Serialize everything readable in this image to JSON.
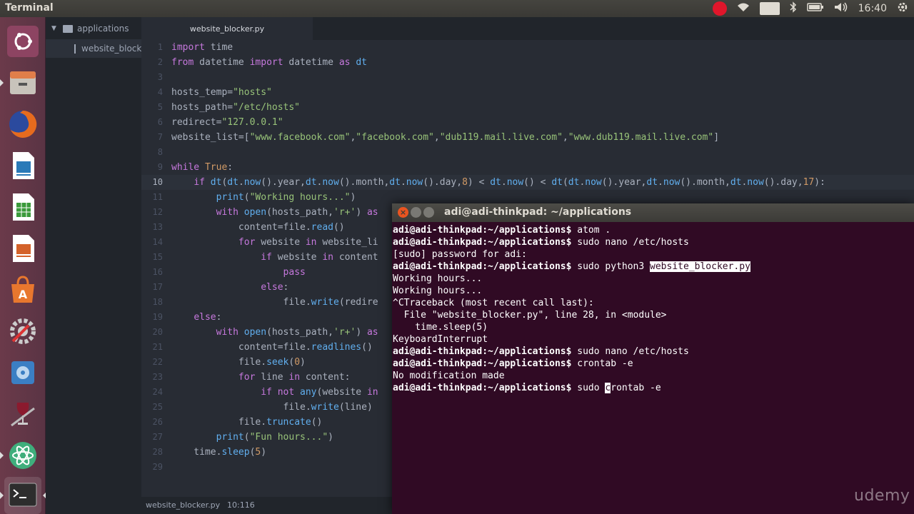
{
  "top_panel": {
    "app_title": "Terminal",
    "keyboard_layout": "No",
    "clock": "16:40"
  },
  "launcher": {
    "items": [
      "ubuntu-dash-icon",
      "files-icon",
      "firefox-icon",
      "writer-icon",
      "calc-icon",
      "impress-icon",
      "software-center-icon",
      "system-settings-icon",
      "disk-utility-icon",
      "wine-tools-icon",
      "atom-icon",
      "terminal-icon"
    ]
  },
  "tree": {
    "folder": "applications",
    "file": "website_blocker"
  },
  "tab": {
    "label": "website_blocker.py"
  },
  "editor": {
    "current_line": 10,
    "lines": [
      "import time",
      "from datetime import datetime as dt",
      "",
      "hosts_temp=\"hosts\"",
      "hosts_path=\"/etc/hosts\"",
      "redirect=\"127.0.0.1\"",
      "website_list=[\"www.facebook.com\",\"facebook.com\",\"dub119.mail.live.com\",\"www.dub119.mail.live.com\"]",
      "",
      "while True:",
      "    if dt(dt.now().year,dt.now().month,dt.now().day,8) < dt.now() < dt(dt.now().year,dt.now().month,dt.now().day,17):",
      "        print(\"Working hours...\")",
      "        with open(hosts_path,'r+') as",
      "            content=file.read()",
      "            for website in website_li",
      "                if website in content",
      "                    pass",
      "                else:",
      "                    file.write(redire",
      "    else:",
      "        with open(hosts_path,'r+') as",
      "            content=file.readlines()",
      "            file.seek(0)",
      "            for line in content:",
      "                if not any(website in",
      "                    file.write(line)",
      "            file.truncate()",
      "        print(\"Fun hours...\")",
      "    time.sleep(5)",
      ""
    ]
  },
  "statusbar": {
    "file": "website_blocker.py",
    "position": "10:116"
  },
  "terminal": {
    "title": "adi@adi-thinkpad: ~/applications",
    "prompt": "adi@adi-thinkpad:~/applications$ ",
    "lines": [
      {
        "prompt": true,
        "text": "atom ."
      },
      {
        "prompt": true,
        "text": "sudo nano /etc/hosts"
      },
      {
        "prompt": false,
        "text": "[sudo] password for adi:"
      },
      {
        "prompt": true,
        "text": "sudo python3 ",
        "selected": "website_blocker.py"
      },
      {
        "prompt": false,
        "text": "Working hours..."
      },
      {
        "prompt": false,
        "text": "Working hours..."
      },
      {
        "prompt": false,
        "text": "^CTraceback (most recent call last):"
      },
      {
        "prompt": false,
        "text": "  File \"website_blocker.py\", line 28, in <module>"
      },
      {
        "prompt": false,
        "text": "    time.sleep(5)"
      },
      {
        "prompt": false,
        "text": "KeyboardInterrupt"
      },
      {
        "prompt": true,
        "text": "sudo nano /etc/hosts"
      },
      {
        "prompt": true,
        "text": "crontab -e"
      },
      {
        "prompt": false,
        "text": "No modification made"
      },
      {
        "prompt": true,
        "text": "sudo ",
        "cursor": "c",
        "after": "rontab -e"
      }
    ]
  },
  "watermark": "udemy"
}
